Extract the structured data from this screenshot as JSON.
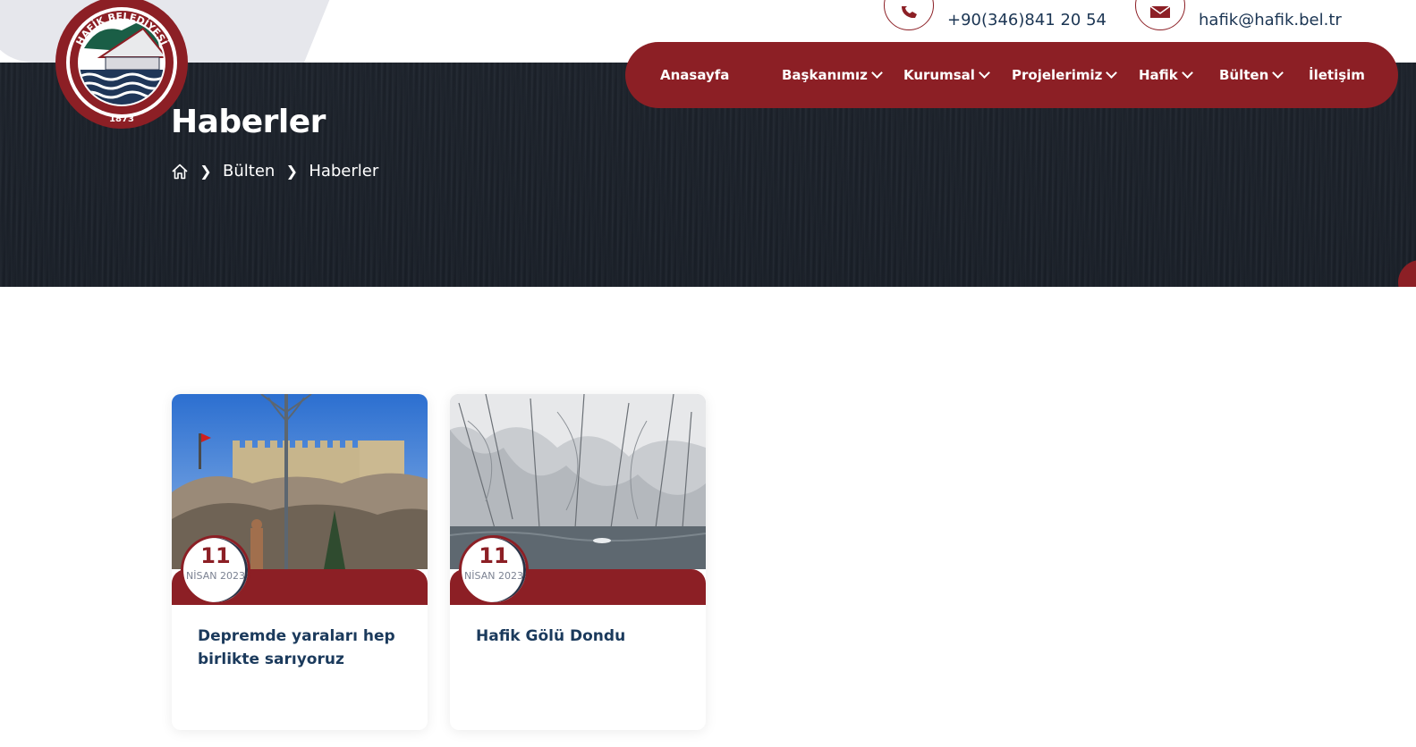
{
  "header": {
    "logo": {
      "icon": "hafik-belediyesi-logo",
      "text_top": "HAFİK BELEDİYESİ",
      "year": "1873"
    },
    "contact": {
      "phone": {
        "icon": "phone-icon",
        "text": "+90(346)841 20 54"
      },
      "email": {
        "icon": "envelope-icon",
        "text": "hafik@hafik.bel.tr"
      }
    },
    "nav": {
      "items": [
        {
          "label": "Anasayfa",
          "dropdown": false
        },
        {
          "label": "Başkanımız",
          "dropdown": true
        },
        {
          "label": "Kurumsal",
          "dropdown": true
        },
        {
          "label": "Projelerimiz",
          "dropdown": true
        },
        {
          "label": "Hafik",
          "dropdown": true
        },
        {
          "label": "Bülten",
          "dropdown": true
        },
        {
          "label": "İletişim",
          "dropdown": false
        }
      ]
    }
  },
  "hero": {
    "title": "Haberler",
    "breadcrumb": {
      "home_icon": "home-icon",
      "items": [
        "Bülten",
        "Haberler"
      ]
    }
  },
  "news": [
    {
      "day": "11",
      "month": "NİSAN 2023",
      "title": "Depremde yaraları hep birlikte sarıyoruz",
      "image": "castle-hill-photo"
    },
    {
      "day": "11",
      "month": "NİSAN 2023",
      "title": "Hafik Gölü Dondu",
      "image": "frozen-lake-trees-photo"
    }
  ],
  "colors": {
    "brand_red": "#8c1f25",
    "navy_text": "#1b3a5c",
    "hero_bg": "#1c222b"
  }
}
